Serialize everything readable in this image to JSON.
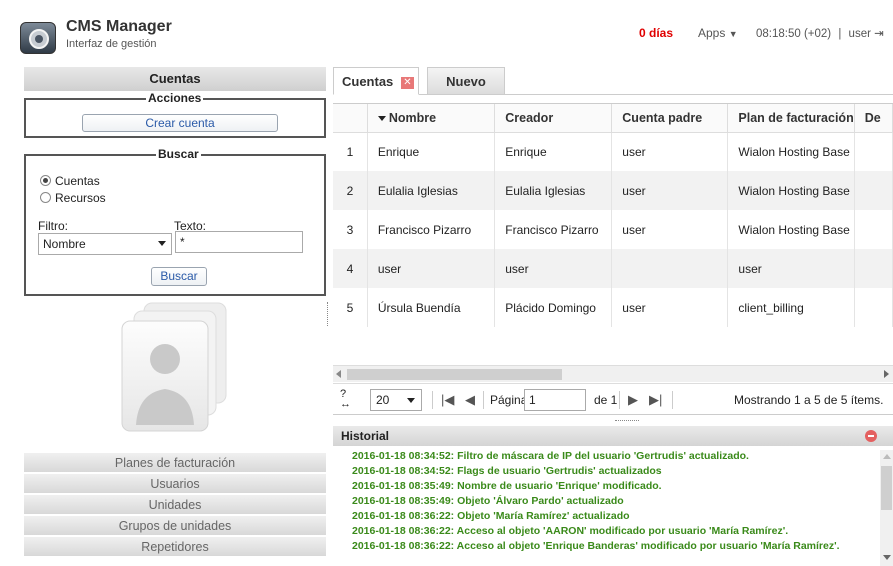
{
  "header": {
    "title": "CMS Manager",
    "subtitle": "Interfaz de gestión",
    "days": "0 días",
    "apps_label": "Apps",
    "clock": "08:18:50 (+02)",
    "separator": "|",
    "user": "user"
  },
  "left": {
    "title": "Cuentas",
    "acciones": {
      "legend": "Acciones",
      "create_label": "Crear cuenta"
    },
    "buscar": {
      "legend": "Buscar",
      "radio_cuentas": "Cuentas",
      "radio_recursos": "Recursos",
      "selected": "Cuentas",
      "filtro_label": "Filtro:",
      "texto_label": "Texto:",
      "filtro_value": "Nombre",
      "texto_value": "*",
      "buscar_label": "Buscar"
    },
    "nav": [
      "Planes de facturación",
      "Usuarios",
      "Unidades",
      "Grupos de unidades",
      "Repetidores"
    ]
  },
  "tabs": {
    "active": "Cuentas",
    "close_glyph": "✕",
    "new": "Nuevo"
  },
  "table": {
    "columns": [
      "",
      "Nombre",
      "Creador",
      "Cuenta padre",
      "Plan de facturación",
      "De"
    ],
    "sorted_column": "Nombre",
    "rows": [
      [
        "1",
        "Enrique",
        "Enrique",
        "user",
        "Wialon Hosting Base",
        ""
      ],
      [
        "2",
        "Eulalia Iglesias",
        "Eulalia Iglesias",
        "user",
        "Wialon Hosting Base",
        ""
      ],
      [
        "3",
        "Francisco Pizarro",
        "Francisco Pizarro",
        "user",
        "Wialon Hosting Base",
        ""
      ],
      [
        "4",
        "user",
        "user",
        "",
        "user",
        ""
      ],
      [
        "5",
        "Úrsula Buendía",
        "Plácido Domingo",
        "user",
        "client_billing",
        ""
      ]
    ]
  },
  "pager": {
    "page_size": "20",
    "page_label": "Página",
    "page_value": "1",
    "of_label": "de 1",
    "status": "Mostrando 1 a 5 de 5 ítems."
  },
  "historial": {
    "title": "Historial",
    "lines": [
      "2016-01-18 08:34:52: Filtro de máscara de IP del usuario 'Gertrudis' actualizado.",
      "2016-01-18 08:34:52: Flags de usuario 'Gertrudis' actualizados",
      "2016-01-18 08:35:49: Nombre de usuario 'Enrique' modificado.",
      "2016-01-18 08:35:49: Objeto 'Álvaro Pardo' actualizado",
      "2016-01-18 08:36:22: Objeto 'María Ramírez' actualizado",
      "2016-01-18 08:36:22: Acceso al objeto 'AARON' modificado por usuario 'María Ramírez'.",
      "2016-01-18 08:36:22: Acceso al objeto 'Enrique Banderas' modificado por usuario 'María Ramírez'."
    ]
  },
  "colors": {
    "days": "#e00000",
    "history_text": "#3a8a1a",
    "link_blue": "#2a5aa8"
  }
}
